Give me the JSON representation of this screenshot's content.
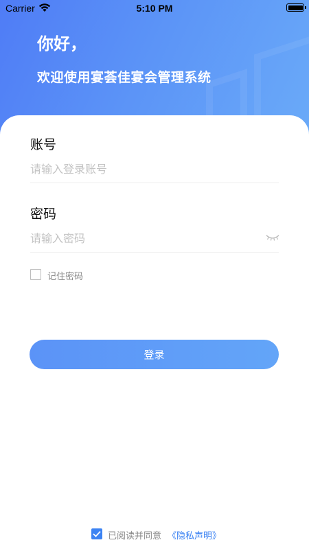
{
  "status_bar": {
    "carrier": "Carrier",
    "time": "5:10 PM"
  },
  "header": {
    "greeting": "你好，",
    "welcome": "欢迎使用宴荟佳宴会管理系统"
  },
  "form": {
    "account_label": "账号",
    "account_placeholder": "请输入登录账号",
    "account_value": "",
    "password_label": "密码",
    "password_placeholder": "请输入密码",
    "password_value": "",
    "remember_label": "记住密码",
    "remember_checked": false
  },
  "login_button_label": "登录",
  "agreement": {
    "checked": true,
    "text": "已阅读并同意",
    "link": "《隐私声明》"
  },
  "colors": {
    "accent": "#3c83f3",
    "header_gradient_start": "#4f7cf6",
    "header_gradient_end": "#6aaaf8"
  },
  "icons": [
    "wifi-icon",
    "battery-icon",
    "eye-closed-icon",
    "checkbox-icon",
    "checkmark-icon"
  ]
}
